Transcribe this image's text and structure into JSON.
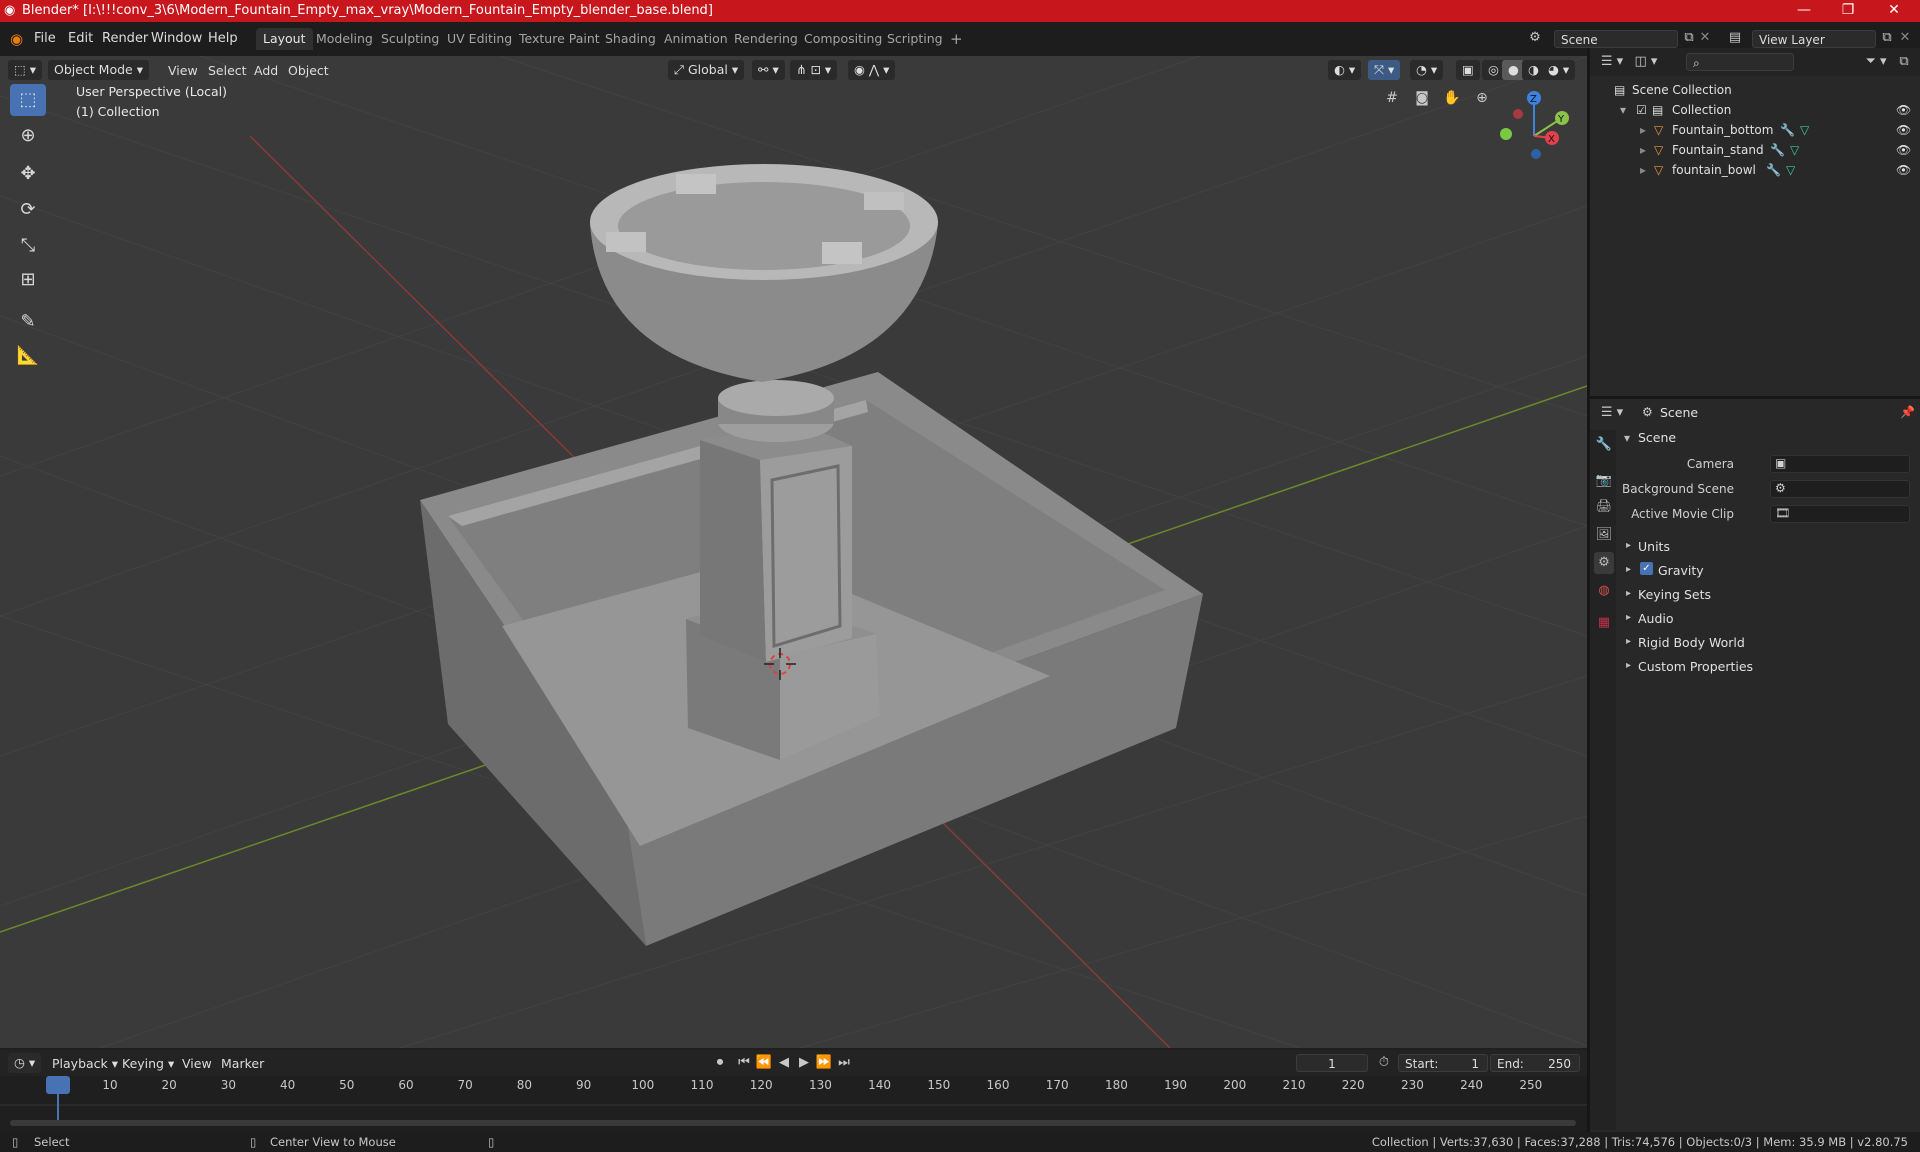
{
  "window": {
    "title": "Blender* [I:\\!!!conv_3\\6\\Modern_Fountain_Empty_max_vray\\Modern_Fountain_Empty_blender_base.blend]",
    "minimize": "—",
    "restore": "❐",
    "close": "✕"
  },
  "menubar": {
    "items": [
      "File",
      "Edit",
      "Render",
      "Window",
      "Help"
    ]
  },
  "workspaces": {
    "tabs": [
      "Layout",
      "Modeling",
      "Sculpting",
      "UV Editing",
      "Texture Paint",
      "Shading",
      "Animation",
      "Rendering",
      "Compositing",
      "Scripting"
    ],
    "active": "Layout",
    "add": "+"
  },
  "scene_selector": {
    "value": "Scene"
  },
  "view_layer_selector": {
    "value": "View Layer"
  },
  "viewport_header": {
    "mode": "Object Mode",
    "menus": [
      "View",
      "Select",
      "Add",
      "Object"
    ],
    "transform_orientation": "Global"
  },
  "viewport": {
    "perspective_label": "User Perspective (Local)",
    "collection_label": "(1) Collection",
    "gizmo": {
      "z": "Z",
      "y": "Y",
      "x": "X"
    }
  },
  "outliner": {
    "root": "Scene Collection",
    "collection": "Collection",
    "objects": [
      "Fountain_bottom",
      "Fountain_stand",
      "fountain_bowl"
    ]
  },
  "properties": {
    "header": "Scene",
    "section": "Scene",
    "fields": [
      {
        "label": "Camera"
      },
      {
        "label": "Background Scene"
      },
      {
        "label": "Active Movie Clip"
      }
    ],
    "panels": [
      "Units",
      "Gravity",
      "Keying Sets",
      "Audio",
      "Rigid Body World",
      "Custom Properties"
    ],
    "gravity_checked": true
  },
  "timeline": {
    "menus": [
      "Playback",
      "Keying",
      "View",
      "Marker"
    ],
    "current_frame": "1",
    "start_label": "Start:",
    "start": "1",
    "end_label": "End:",
    "end": "250",
    "ticks": [
      "1",
      "10",
      "20",
      "30",
      "40",
      "50",
      "60",
      "70",
      "80",
      "90",
      "100",
      "110",
      "120",
      "130",
      "140",
      "150",
      "160",
      "170",
      "180",
      "190",
      "200",
      "210",
      "220",
      "230",
      "240",
      "250"
    ]
  },
  "statusbar": {
    "select": "Select",
    "center_view": "Center View to Mouse",
    "stats": "Collection | Verts:37,630 | Faces:37,288 | Tris:74,576 | Objects:0/3 | Mem: 35.9 MB | v2.80.75"
  },
  "colors": {
    "titlebar": "#c8161d",
    "accent": "#4772b3",
    "x_axis": "#e2414c",
    "y_axis": "#8bc34a",
    "z_axis": "#3b83e0",
    "object_icon": "#e89a3c"
  }
}
